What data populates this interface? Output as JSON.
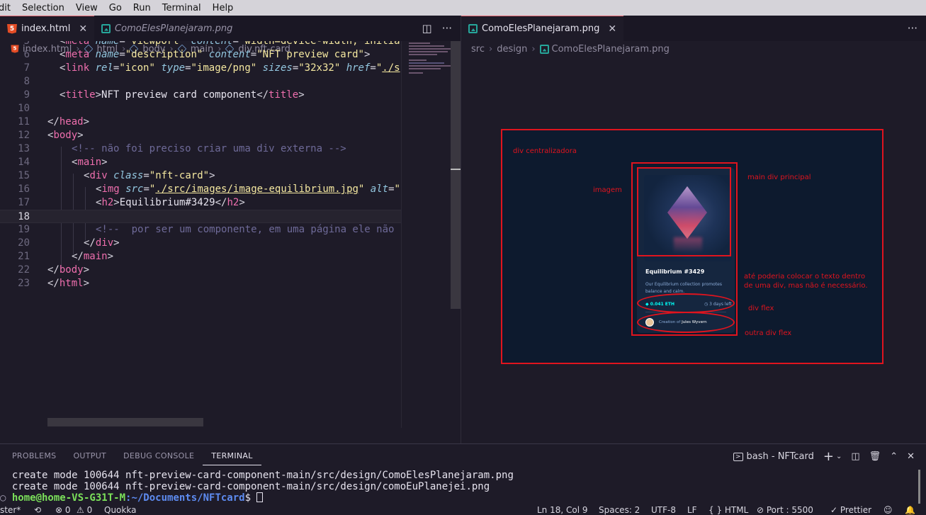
{
  "menu": [
    "dit",
    "Selection",
    "View",
    "Go",
    "Run",
    "Terminal",
    "Help"
  ],
  "left_editor": {
    "tabs": [
      {
        "label": "index.html",
        "active": true
      },
      {
        "label": "ComoElesPlanejaram.png",
        "active": false
      }
    ],
    "breadcrumb": [
      "index.html",
      "html",
      "body",
      "main",
      "div.nft-card"
    ],
    "line_numbers": [
      "5",
      "6",
      "7",
      "8",
      "9",
      "10",
      "11",
      "12",
      "13",
      "14",
      "15",
      "16",
      "17",
      "18",
      "19",
      "20",
      "21",
      "22",
      "23"
    ],
    "current_line": "18"
  },
  "right_editor": {
    "tab": "ComoElesPlanejaram.png",
    "breadcrumb": [
      "src",
      "design",
      "ComoElesPlanejaram.png"
    ]
  },
  "image": {
    "labels": {
      "centralizer": "div centralizadora",
      "main": "main div principal",
      "image": "imagem",
      "text_note_1": "até poderia colocar o texto dentro",
      "text_note_2": "de uma div, mas não é necessário.",
      "div_flex": "div flex",
      "other_div_flex": "outra div flex"
    },
    "card": {
      "title": "Equilibrium #3429",
      "description": "Our Equilibrium collection promotes balance and calm.",
      "price": "◆ 0.041 ETH",
      "days": "◷ 3 days left",
      "creator_prefix": "Creation of ",
      "creator_name": "Jules Wyvern"
    }
  },
  "panel": {
    "tabs": [
      "PROBLEMS",
      "OUTPUT",
      "DEBUG CONSOLE",
      "TERMINAL"
    ],
    "active_tab": "TERMINAL",
    "terminal_name": "bash - NFTcard",
    "lines": [
      "  create mode 100644 nft-preview-card-component-main/src/design/ComoElesPlanejaram.png",
      "  create mode 100644 nft-preview-card-component-main/src/design/comoEuPlanejei.png"
    ],
    "prompt_user": "home@home-VS-G31T-M",
    "prompt_path": ":~/Documents/NFTcard",
    "prompt_symbol": "$ "
  },
  "status": {
    "branch": "ster*",
    "errors": "⊗ 0",
    "warnings": "⚠ 0",
    "quokka": "Quokka",
    "position": "Ln 18, Col 9",
    "spaces": "Spaces: 2",
    "encoding": "UTF-8",
    "eol": "LF",
    "language": "{ } HTML",
    "port": "⊘ Port : 5500",
    "prettier": "✓ Prettier"
  }
}
